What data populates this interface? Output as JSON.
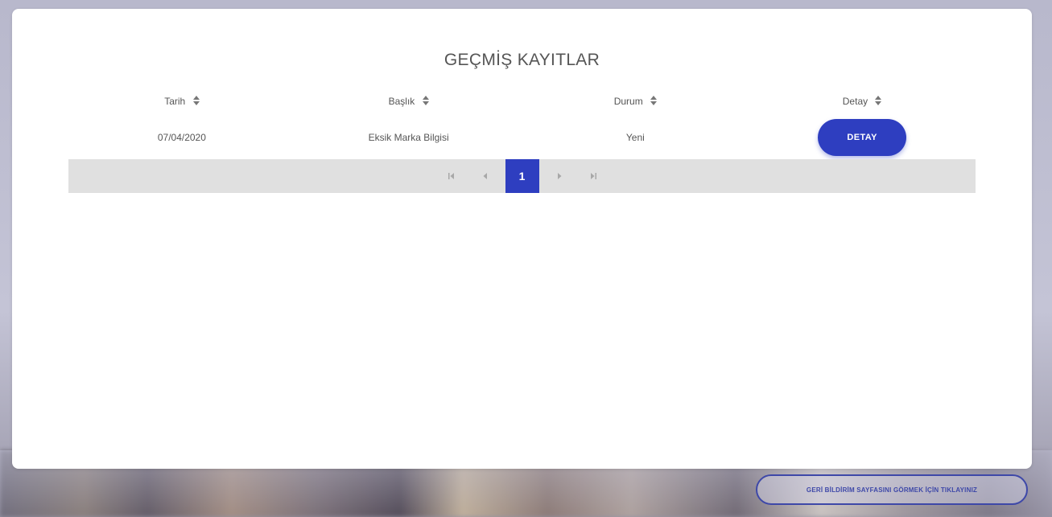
{
  "title": "GEÇMİŞ KAYITLAR",
  "table": {
    "headers": [
      "Tarih",
      "Başlık",
      "Durum",
      "Detay"
    ],
    "rows": [
      {
        "tarih": "07/04/2020",
        "baslik": "Eksik Marka Bilgisi",
        "durum": "Yeni",
        "detay_label": "DETAY"
      }
    ]
  },
  "pagination": {
    "current_page": "1",
    "icons": [
      "first-page-icon",
      "prev-page-icon",
      "next-page-icon",
      "last-page-icon"
    ]
  },
  "feedback_button_label": "GERİ BİLDİRİM SAYFASINI GÖRMEK İÇİN TIKLAYINIZ",
  "colors": {
    "accent": "#2e3ec0",
    "pager_bg": "#e0e0e0",
    "text": "#555555"
  }
}
